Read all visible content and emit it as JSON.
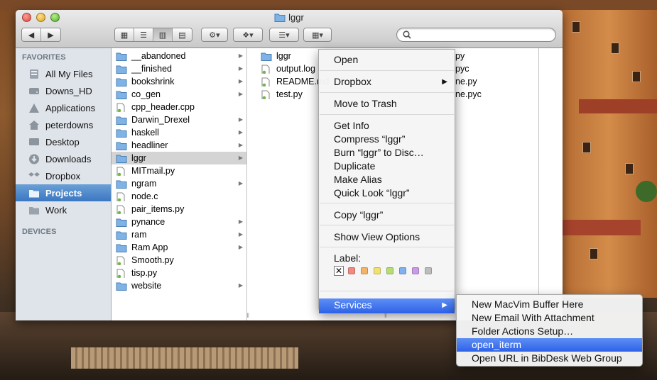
{
  "window": {
    "title": "lggr"
  },
  "sidebar": {
    "favorites_header": "FAVORITES",
    "devices_header": "DEVICES",
    "items": [
      {
        "label": "All My Files",
        "icon": "all-files-icon"
      },
      {
        "label": "Downs_HD",
        "icon": "hard-drive-icon"
      },
      {
        "label": "Applications",
        "icon": "applications-icon"
      },
      {
        "label": "peterdowns",
        "icon": "home-icon"
      },
      {
        "label": "Desktop",
        "icon": "desktop-icon"
      },
      {
        "label": "Downloads",
        "icon": "downloads-icon"
      },
      {
        "label": "Dropbox",
        "icon": "dropbox-icon"
      },
      {
        "label": "Projects",
        "icon": "folder-icon",
        "selected": true
      },
      {
        "label": "Work",
        "icon": "folder-icon"
      }
    ]
  },
  "column1": {
    "items": [
      {
        "label": "__abandoned",
        "type": "folder"
      },
      {
        "label": "__finished",
        "type": "folder"
      },
      {
        "label": "bookshrink",
        "type": "folder"
      },
      {
        "label": "co_gen",
        "type": "folder"
      },
      {
        "label": "cpp_header.cpp",
        "type": "file"
      },
      {
        "label": "Darwin_Drexel",
        "type": "folder"
      },
      {
        "label": "haskell",
        "type": "folder"
      },
      {
        "label": "headliner",
        "type": "folder"
      },
      {
        "label": "lggr",
        "type": "folder",
        "selected": true
      },
      {
        "label": "MITmail.py",
        "type": "file"
      },
      {
        "label": "ngram",
        "type": "folder"
      },
      {
        "label": "node.c",
        "type": "file"
      },
      {
        "label": "pair_items.py",
        "type": "file"
      },
      {
        "label": "pynance",
        "type": "folder"
      },
      {
        "label": "ram",
        "type": "folder"
      },
      {
        "label": "Ram App",
        "type": "folder"
      },
      {
        "label": "Smooth.py",
        "type": "file"
      },
      {
        "label": "tisp.py",
        "type": "file"
      },
      {
        "label": "website",
        "type": "folder"
      }
    ]
  },
  "column2": {
    "items": [
      {
        "label": "lggr",
        "type": "folder"
      },
      {
        "label": "output.log",
        "type": "file"
      },
      {
        "label": "README.md",
        "type": "file"
      },
      {
        "label": "test.py",
        "type": "file"
      }
    ],
    "partial_right": [
      "py",
      "pyc",
      "ne.py",
      "ne.pyc"
    ]
  },
  "context_menu": {
    "items": [
      {
        "label": "Open"
      },
      {
        "label": "Dropbox",
        "submenu": true
      },
      {
        "label": "Move to Trash"
      },
      {
        "label": "Get Info"
      },
      {
        "label": "Compress “lggr”"
      },
      {
        "label": "Burn “lggr” to Disc…"
      },
      {
        "label": "Duplicate"
      },
      {
        "label": "Make Alias"
      },
      {
        "label": "Quick Look “lggr”"
      },
      {
        "label": "Copy “lggr”"
      },
      {
        "label": "Show View Options"
      },
      {
        "label": "Services",
        "submenu": true,
        "highlighted": true
      }
    ],
    "label_title": "Label:",
    "label_colors": [
      "#f08a80",
      "#f5b36a",
      "#f2e070",
      "#b6dc72",
      "#7fb1ee",
      "#c99be6",
      "#bdbdbd"
    ]
  },
  "services_menu": {
    "items": [
      {
        "label": "New MacVim Buffer Here"
      },
      {
        "label": "New Email With Attachment"
      },
      {
        "label": "Folder Actions Setup…"
      },
      {
        "label": "open_iterm",
        "highlighted": true
      },
      {
        "label": "Open URL in BibDesk Web Group"
      }
    ]
  },
  "colors": {
    "accent": "#3b77c1",
    "menu_highlight": "#2d62e8",
    "folder": "#7fb3e6"
  }
}
